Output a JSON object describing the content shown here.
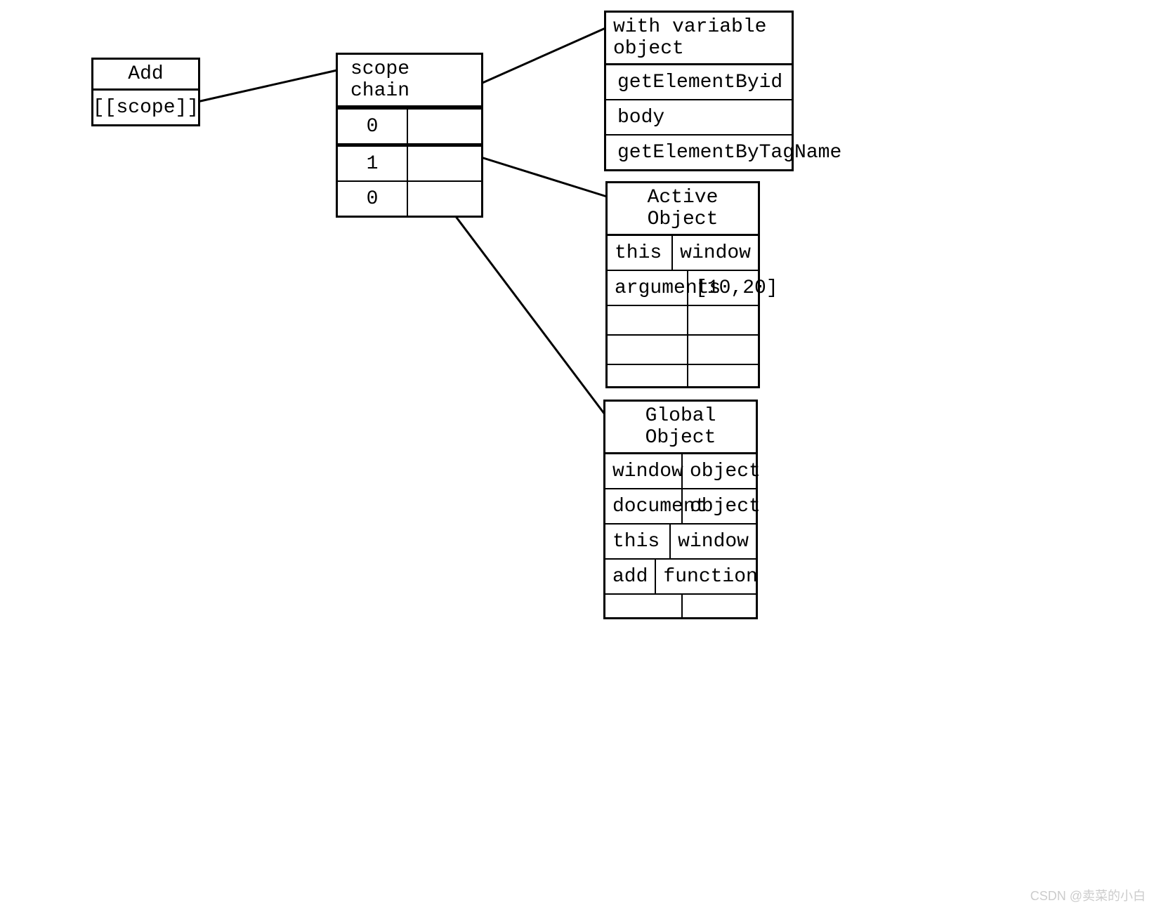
{
  "addBox": {
    "title": "Add",
    "scope": "[[scope]]"
  },
  "scopeChain": {
    "title": "scope chain",
    "rows": [
      "0",
      "1",
      "0"
    ]
  },
  "withVarObj": {
    "title": "with variable object",
    "rows": [
      "getElementByid",
      "body",
      "getElementByTagName"
    ]
  },
  "activeObj": {
    "title": "Active Object",
    "rows": [
      {
        "key": "this",
        "val": "window"
      },
      {
        "key": "arguments",
        "val": "[10,20]"
      },
      {
        "key": "",
        "val": ""
      },
      {
        "key": "",
        "val": ""
      },
      {
        "key": "",
        "val": ""
      }
    ]
  },
  "globalObj": {
    "title": "Global Object",
    "rows": [
      {
        "key": "window",
        "val": "object"
      },
      {
        "key": "document",
        "val": "object"
      },
      {
        "key": "this",
        "val": "window"
      },
      {
        "key": "add",
        "val": "function"
      },
      {
        "key": "",
        "val": ""
      }
    ]
  },
  "watermark": "CSDN @卖菜的小白"
}
